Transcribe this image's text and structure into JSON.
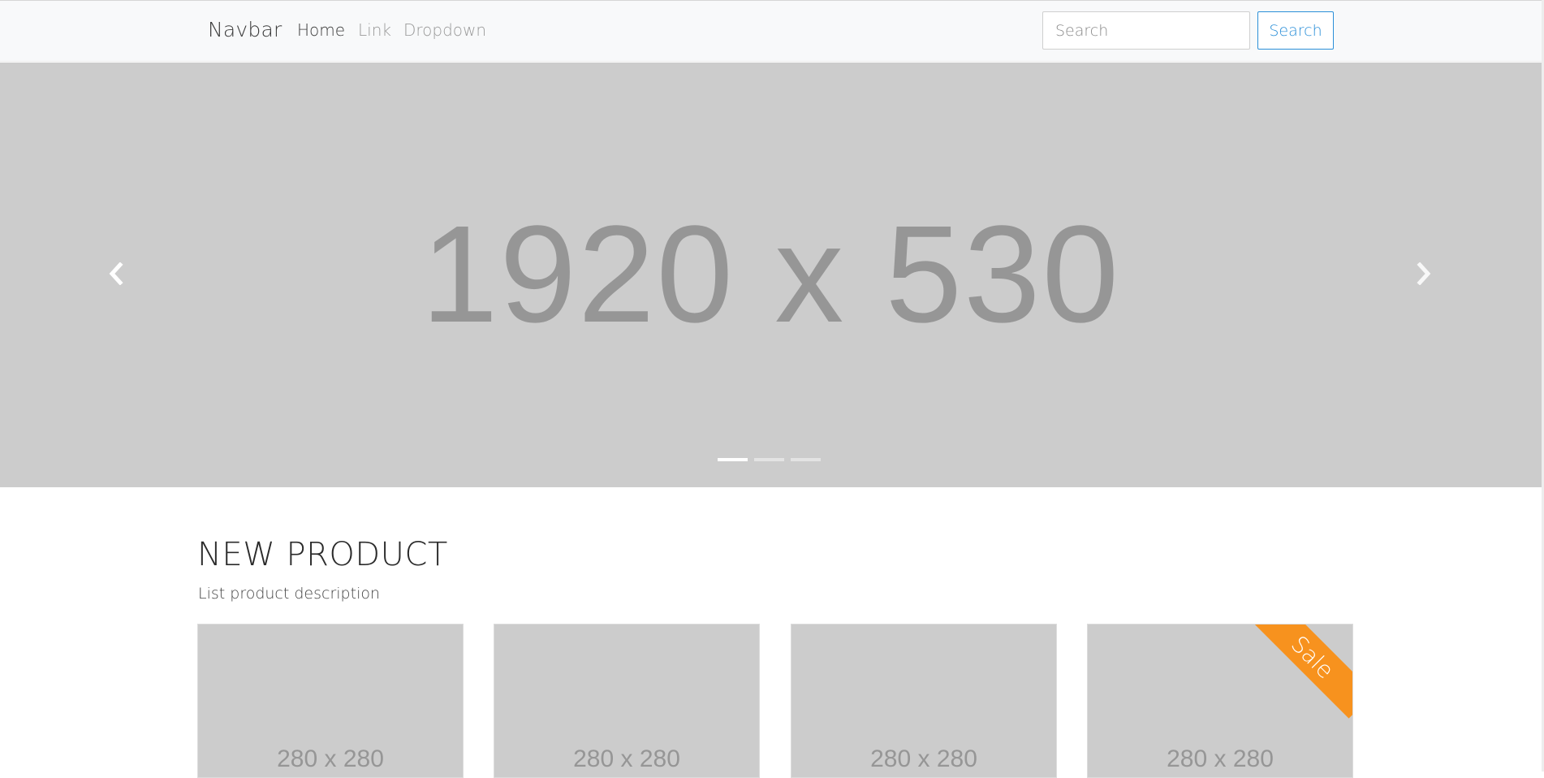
{
  "navbar": {
    "brand": "Navbar",
    "links": [
      {
        "label": "Home",
        "active": true
      },
      {
        "label": "Link",
        "active": false
      },
      {
        "label": "Dropdown",
        "active": false
      }
    ],
    "search": {
      "placeholder": "Search",
      "button_label": "Search"
    }
  },
  "carousel": {
    "placeholder_text": "1920 x 530",
    "slide_count": 3,
    "active_slide": 1,
    "controls": {
      "prev_icon": "chevron-left-icon",
      "next_icon": "chevron-right-icon"
    }
  },
  "section": {
    "title": "NEW PRODUCT",
    "description": "List product description"
  },
  "products": [
    {
      "image_text": "280 x 280",
      "badge": ""
    },
    {
      "image_text": "280 x 280",
      "badge": ""
    },
    {
      "image_text": "280 x 280",
      "badge": ""
    },
    {
      "image_text": "280 x 280",
      "badge": "Sale"
    }
  ],
  "colors": {
    "navbar_bg": "#f8f9fa",
    "accent": "#2b8fd8",
    "placeholder_bg": "#cccccc",
    "placeholder_text": "#969696",
    "sale_ribbon": "#f7921e"
  }
}
